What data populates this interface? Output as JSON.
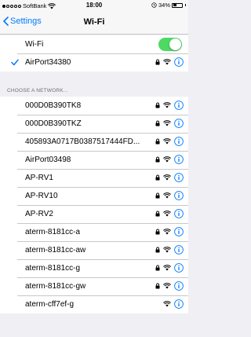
{
  "status_bar": {
    "carrier": "SoftBank",
    "time": "18:00",
    "battery_text": "34%",
    "battery_level": 0.34
  },
  "nav": {
    "back_label": "Settings",
    "title": "Wi-Fi"
  },
  "wifi_toggle": {
    "label": "Wi-Fi",
    "on": true
  },
  "connected": {
    "name": "AirPort34380",
    "locked": true
  },
  "section_header": "CHOOSE A NETWORK...",
  "networks": [
    {
      "name": "000D0B390TK8",
      "locked": true
    },
    {
      "name": "000D0B390TKZ",
      "locked": true
    },
    {
      "name": "405893A0717B0387517444FD...",
      "locked": true
    },
    {
      "name": "AirPort03498",
      "locked": true
    },
    {
      "name": "AP-RV1",
      "locked": true
    },
    {
      "name": "AP-RV10",
      "locked": true
    },
    {
      "name": "AP-RV2",
      "locked": true
    },
    {
      "name": "aterm-8181cc-a",
      "locked": true
    },
    {
      "name": "aterm-8181cc-aw",
      "locked": true
    },
    {
      "name": "aterm-8181cc-g",
      "locked": true
    },
    {
      "name": "aterm-8181cc-gw",
      "locked": true
    },
    {
      "name": "aterm-cff7ef-g",
      "locked": false
    }
  ],
  "colors": {
    "accent": "#007aff",
    "toggle_on": "#4cd964",
    "background": "#efeff4"
  }
}
